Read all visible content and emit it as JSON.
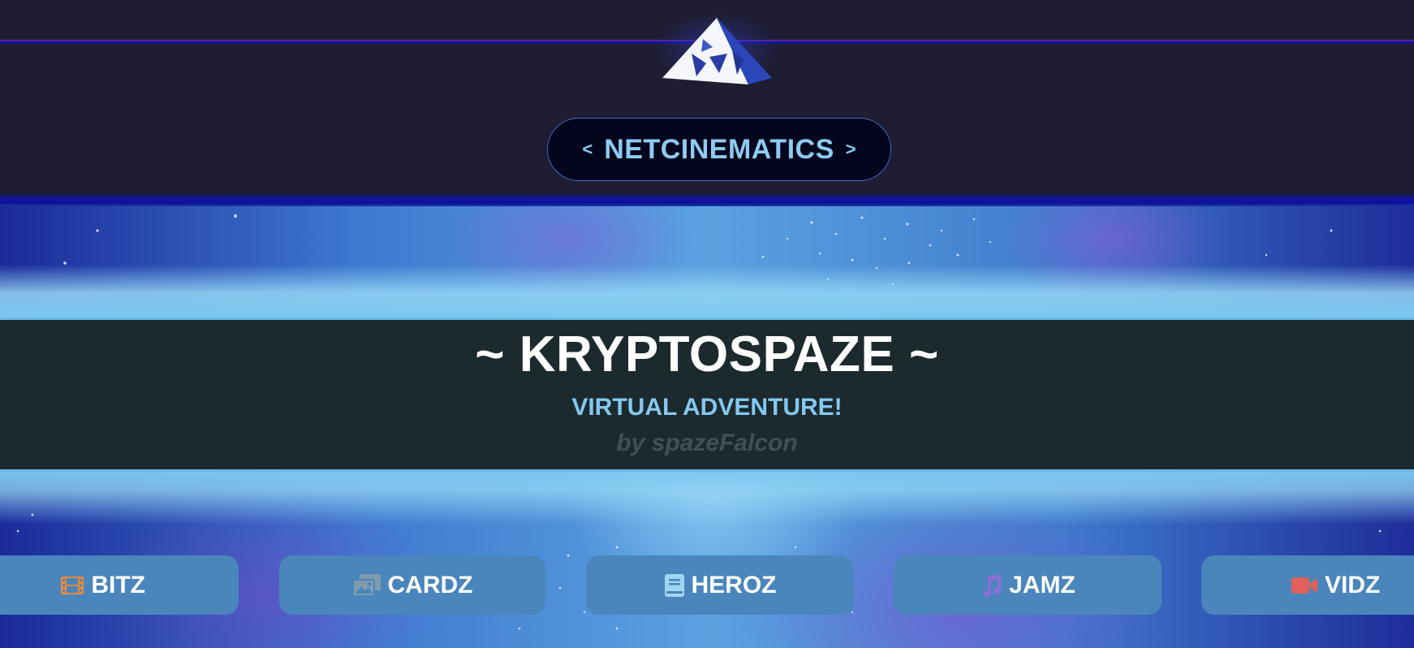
{
  "header": {
    "logo_icon": "pyramid-logo-icon",
    "site_pill": {
      "left_arrow": "<",
      "name": "NETCINEMATICS",
      "right_arrow": ">"
    }
  },
  "banner": {
    "title": "~ KRYPTOSPAZE ~",
    "subtitle": "VIRTUAL ADVENTURE!",
    "author": "by spazeFalcon"
  },
  "nav": {
    "items": [
      {
        "label": "BITZ",
        "icon": "film-icon",
        "icon_color": "#e8893a"
      },
      {
        "label": "CARDZ",
        "icon": "images-icon",
        "icon_color": "#7f9cae"
      },
      {
        "label": "HEROZ",
        "icon": "book-icon",
        "icon_color": "#9fd6f2"
      },
      {
        "label": "JAMZ",
        "icon": "music-icon",
        "icon_color": "#8a6fd6"
      },
      {
        "label": "VIDZ",
        "icon": "video-icon",
        "icon_color": "#e0605a"
      }
    ]
  },
  "colors": {
    "header_bg": "#1e1d31",
    "pill_bg": "#03061c",
    "pill_text": "#8ecbf2",
    "title_band_bg": "#1c2a2e",
    "nav_button_bg": "#4a86bc"
  }
}
